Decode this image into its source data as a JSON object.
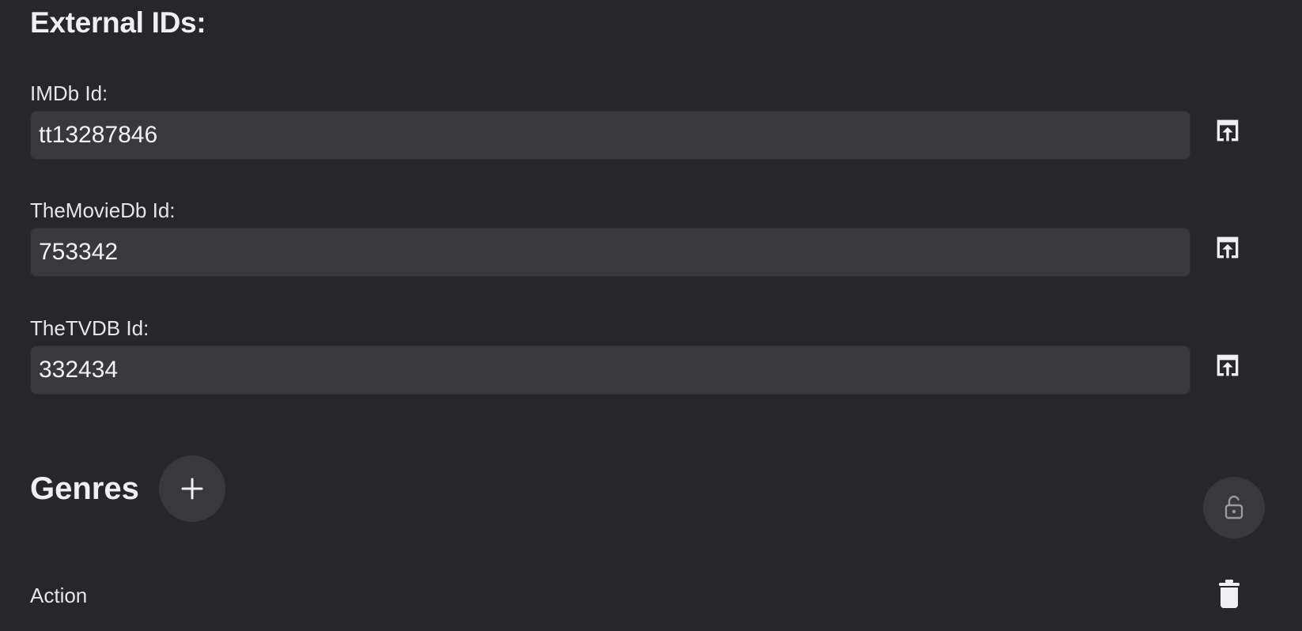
{
  "external_ids": {
    "title": "External IDs:",
    "fields": [
      {
        "label": "IMDb Id:",
        "value": "tt13287846",
        "action_icon": "open-external-icon"
      },
      {
        "label": "TheMovieDb Id:",
        "value": "753342",
        "action_icon": "open-external-icon"
      },
      {
        "label": "TheTVDB Id:",
        "value": "332434",
        "action_icon": "open-external-icon"
      }
    ]
  },
  "genres": {
    "title": "Genres",
    "add_icon": "plus-icon",
    "lock_icon": "unlocked-padlock-icon",
    "items": [
      {
        "label": "Action",
        "delete_icon": "trash-icon"
      }
    ]
  },
  "colors": {
    "background": "#272729",
    "input_bg": "#39393c",
    "text": "#ececee",
    "muted_icon": "#9a9a9d"
  }
}
